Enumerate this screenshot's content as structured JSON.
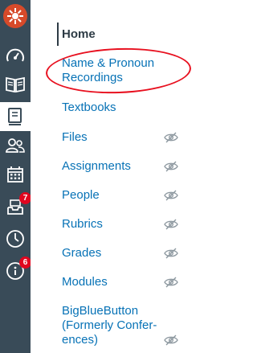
{
  "global_nav": {
    "badges": {
      "inbox": "7",
      "help": "6"
    },
    "icons": [
      "institution-logo",
      "dashboard-icon",
      "courses-icon",
      "courses-active-icon",
      "groups-icon",
      "calendar-icon",
      "inbox-icon",
      "history-icon",
      "help-icon"
    ]
  },
  "course_nav": {
    "home": "Home",
    "name_pronoun": "Name & Pronoun Recordings",
    "textbooks": "Textbooks",
    "files": "Files",
    "assignments": "Assignments",
    "people": "People",
    "rubrics": "Rubrics",
    "grades": "Grades",
    "modules": "Modules",
    "bigbluebutton": "BigBlueButton (Formerly Confer- ences)"
  },
  "colors": {
    "rail_bg": "#394b58",
    "link": "#0772b6",
    "current": "#2d3b45",
    "badge": "#e0061f",
    "annotation": "#e8101f"
  }
}
